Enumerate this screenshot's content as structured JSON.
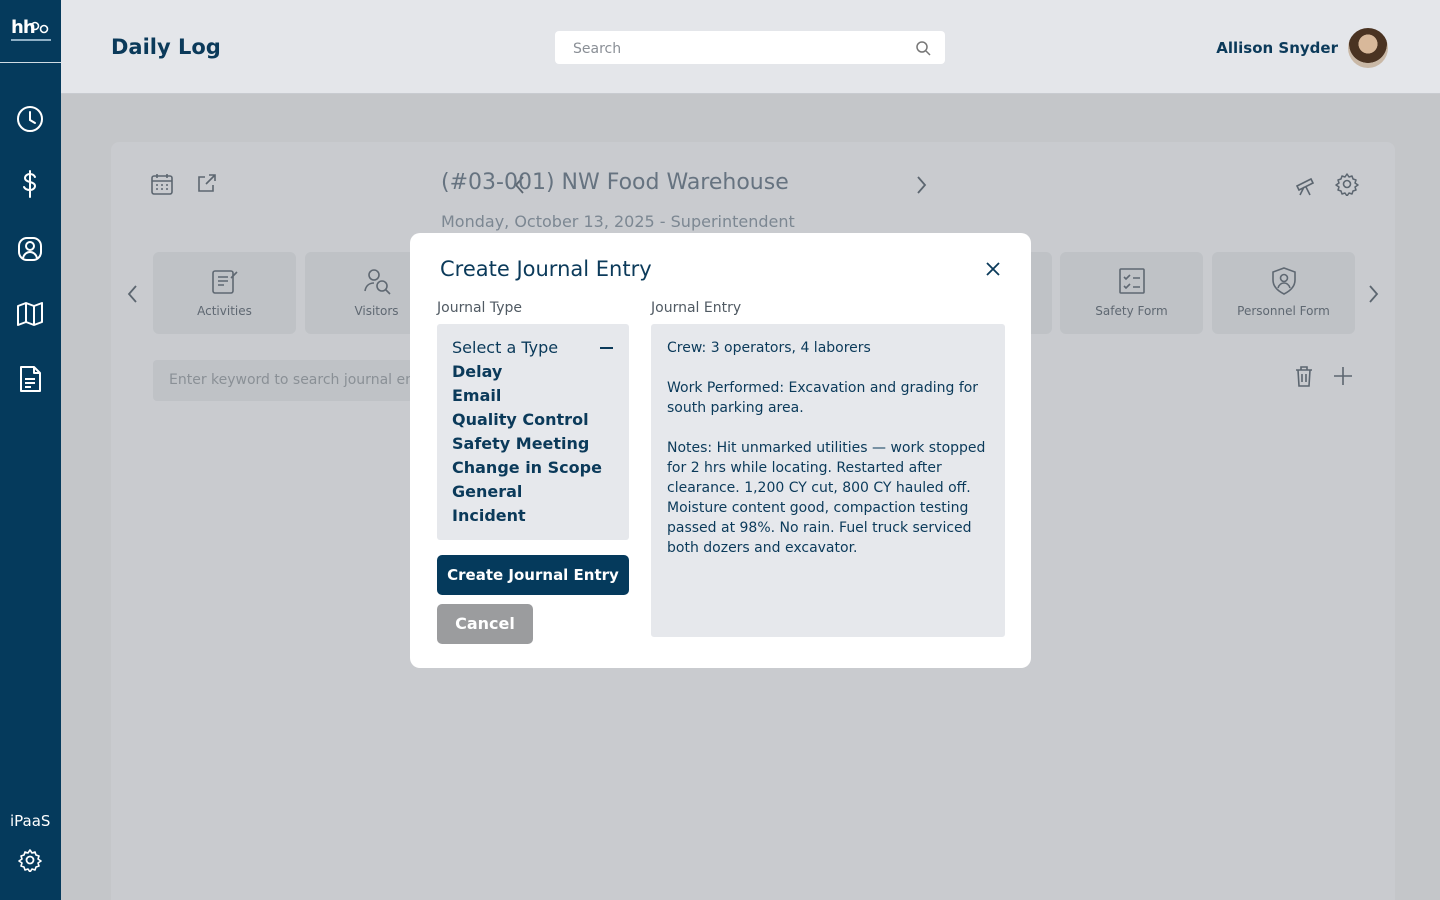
{
  "app": {
    "logo_text": "hh",
    "page_title": "Daily Log"
  },
  "sidebar": {
    "items": [
      {
        "icon": "clock-icon"
      },
      {
        "icon": "dollar-icon"
      },
      {
        "icon": "user-badge-icon"
      },
      {
        "icon": "map-icon"
      },
      {
        "icon": "document-icon"
      }
    ],
    "ipaas_label": "iPaaS",
    "settings_icon": "gear-icon"
  },
  "header": {
    "search_placeholder": "Search",
    "user_name": "Allison Snyder"
  },
  "project": {
    "title": "(#03-001) NW Food Warehouse",
    "subtitle": "Monday, October 13, 2025 - Superintendent"
  },
  "tiles": [
    {
      "label": "Activities",
      "icon": "clipboard-edit-icon"
    },
    {
      "label": "Visitors",
      "icon": "user-search-icon"
    },
    {
      "label": "Safety Form",
      "icon": "checklist-icon"
    },
    {
      "label": "Personnel Form",
      "icon": "shield-user-icon"
    }
  ],
  "journal_search_placeholder": "Enter keyword to search journal en",
  "modal": {
    "title": "Create Journal Entry",
    "type_label": "Journal Type",
    "entry_label": "Journal Entry",
    "type_placeholder": "Select a Type",
    "types": [
      "Delay",
      "Email",
      "Quality Control",
      "Safety Meeting",
      "Change in Scope",
      "General",
      "Incident"
    ],
    "entry_paragraphs": [
      "Crew: 3 operators, 4 laborers",
      "Work Performed: Excavation and grading for south parking area.",
      "Notes: Hit unmarked utilities — work stopped for 2 hrs while locating. Restarted after clearance. 1,200 CY cut, 800 CY hauled off. Moisture content good, compaction testing passed at 98%. No rain. Fuel truck serviced both dozers and excavator."
    ],
    "create_button": "Create Journal Entry",
    "cancel_button": "Cancel"
  },
  "colors": {
    "primary": "#053a5c",
    "topbar": "#e4e6ea",
    "overlay": "#c4c6c9",
    "cancel": "#9b9c9e"
  }
}
